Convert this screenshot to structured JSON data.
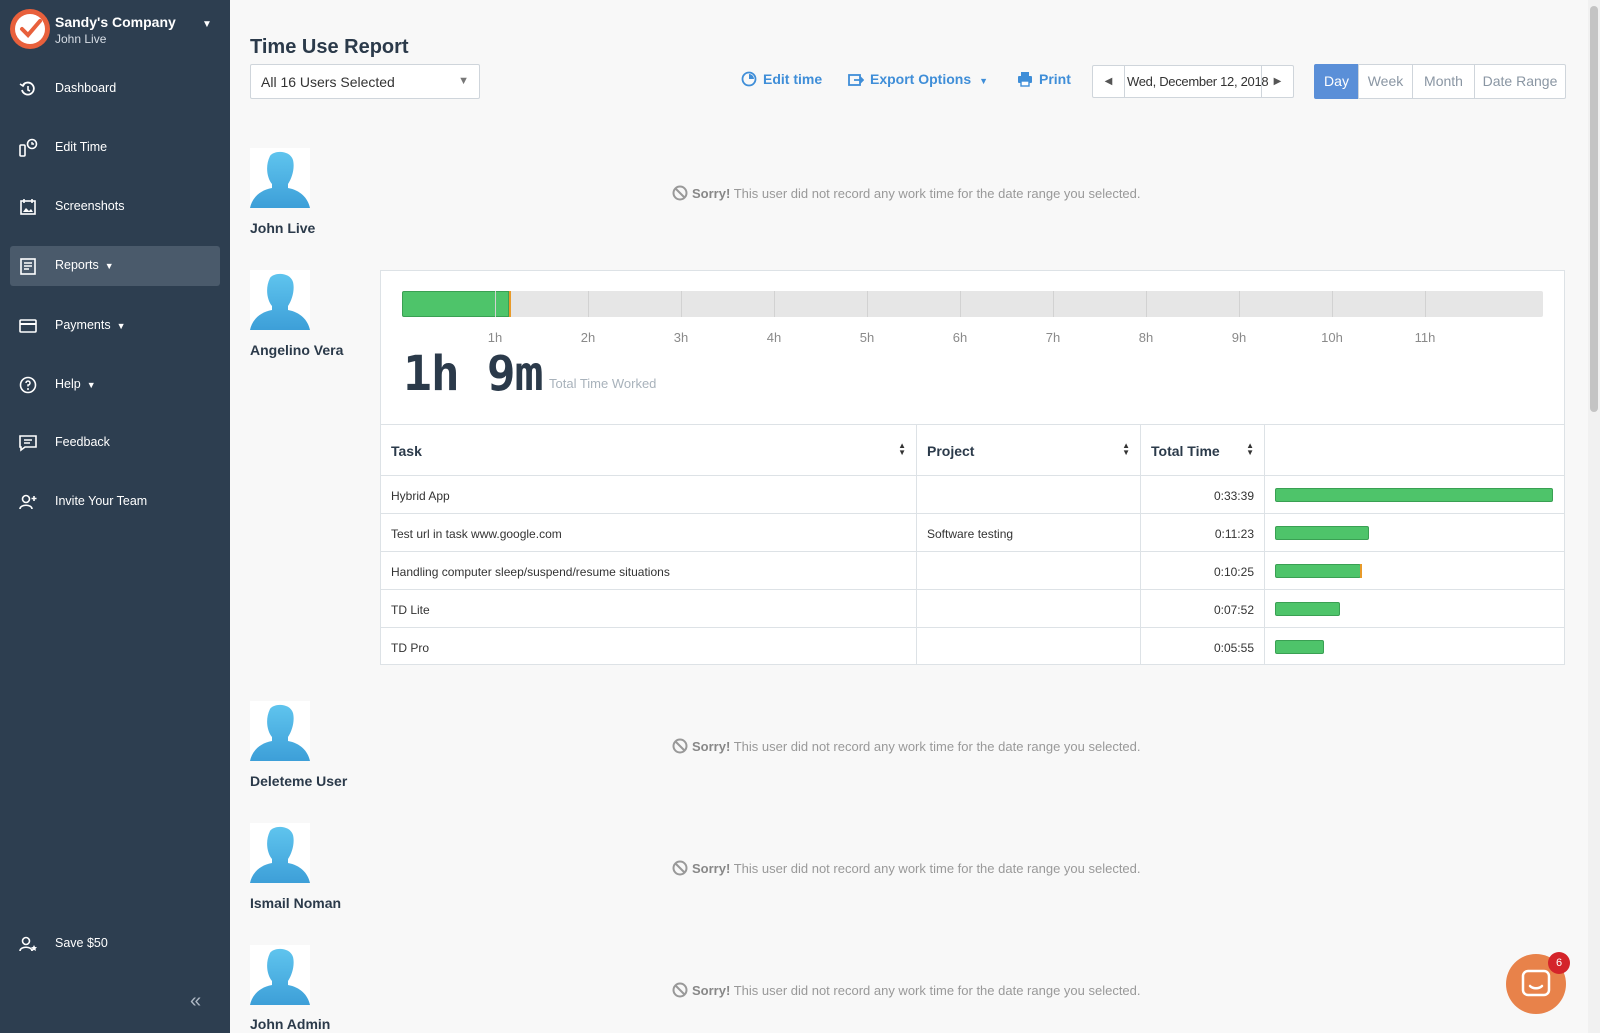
{
  "sidebar": {
    "company": "Sandy's Company",
    "user": "John Live",
    "items": [
      {
        "label": "Dashboard",
        "icon": "dashboard-icon"
      },
      {
        "label": "Edit Time",
        "icon": "edit-time-icon"
      },
      {
        "label": "Screenshots",
        "icon": "screenshots-icon"
      },
      {
        "label": "Reports",
        "icon": "reports-icon"
      },
      {
        "label": "Payments",
        "icon": "payments-icon"
      },
      {
        "label": "Help",
        "icon": "help-icon"
      },
      {
        "label": "Feedback",
        "icon": "feedback-icon"
      },
      {
        "label": "Invite Your Team",
        "icon": "invite-icon"
      }
    ],
    "footer_item": {
      "label": "Save $50",
      "icon": "save-icon"
    },
    "collapse_glyph": "«"
  },
  "header": {
    "title": "Time Use Report",
    "users_select": "All 16 Users Selected",
    "edit_time": "Edit time",
    "export": "Export Options",
    "print": "Print",
    "date": "Wed, December 12, 2018",
    "ranges": [
      "Day",
      "Week",
      "Month",
      "Date Range"
    ],
    "active_range": "Day"
  },
  "users": [
    {
      "name": "John Live"
    },
    {
      "name": "Angelino Vera"
    },
    {
      "name": "Deleteme User"
    },
    {
      "name": "Ismail Noman"
    },
    {
      "name": "John Admin"
    }
  ],
  "no_time_message": {
    "prefix": "Sorry!",
    "text": "This user did not record any work time for the date range you selected."
  },
  "report": {
    "hour_labels": [
      "1h",
      "2h",
      "3h",
      "4h",
      "5h",
      "6h",
      "7h",
      "8h",
      "9h",
      "10h",
      "11h"
    ],
    "timeline_filled_hours": 1.15,
    "total_hours": "1h",
    "total_minutes": "9m",
    "total_label": "Total Time Worked",
    "columns": [
      "Task",
      "Project",
      "Total Time"
    ],
    "rows": [
      {
        "task": "Hybrid App",
        "project": "",
        "time": "0:33:39",
        "fraction": 1.0
      },
      {
        "task": "Test url in task www.google.com",
        "project": "Software testing",
        "time": "0:11:23",
        "fraction": 0.338
      },
      {
        "task": "Handling computer sleep/suspend/resume situations",
        "project": "",
        "time": "0:10:25",
        "fraction": 0.31
      },
      {
        "task": "TD Lite",
        "project": "",
        "time": "0:07:52",
        "fraction": 0.234
      },
      {
        "task": "TD Pro",
        "project": "",
        "time": "0:05:55",
        "fraction": 0.176
      }
    ]
  },
  "chat": {
    "badge": "6"
  }
}
